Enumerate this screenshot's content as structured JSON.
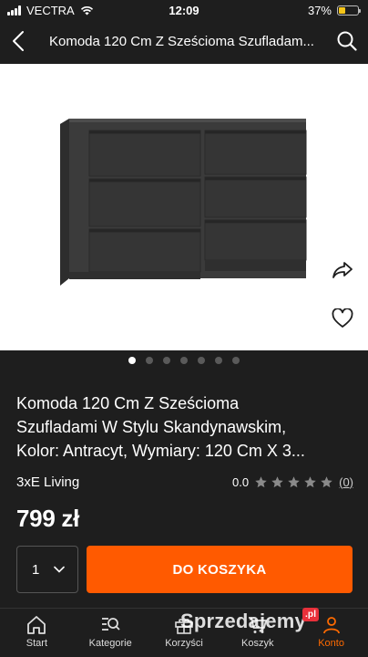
{
  "status_bar": {
    "carrier": "VECTRA",
    "time": "12:09",
    "battery": "37%",
    "battery_level": 0.37
  },
  "header": {
    "title": "Komoda 120 Cm Z Sześcioma Szufladam..."
  },
  "gallery": {
    "total": 7,
    "current": 1
  },
  "product": {
    "title_lines": [
      "Komoda 120 Cm Z Sześcioma",
      "Szufladami W Stylu Skandynawskim,",
      "Kolor: Antracyt, Wymiary: 120 Cm X 3..."
    ],
    "seller": "3xE Living",
    "rating": "0.0",
    "rating_count": "(0)",
    "price": "799 zł"
  },
  "cart": {
    "quantity": "1",
    "add_label": "DO KOSZYKA"
  },
  "nav": [
    {
      "label": "Start",
      "icon": "home-icon"
    },
    {
      "label": "Kategorie",
      "icon": "categories-search-icon"
    },
    {
      "label": "Korzyści",
      "icon": "gift-icon"
    },
    {
      "label": "Koszyk",
      "icon": "cart-icon"
    },
    {
      "label": "Konto",
      "icon": "account-icon"
    }
  ],
  "watermark": {
    "text": "Sprzedajemy",
    "suffix": ".pl"
  },
  "colors": {
    "accent": "#ff5a00",
    "background": "#1e1e1e"
  }
}
